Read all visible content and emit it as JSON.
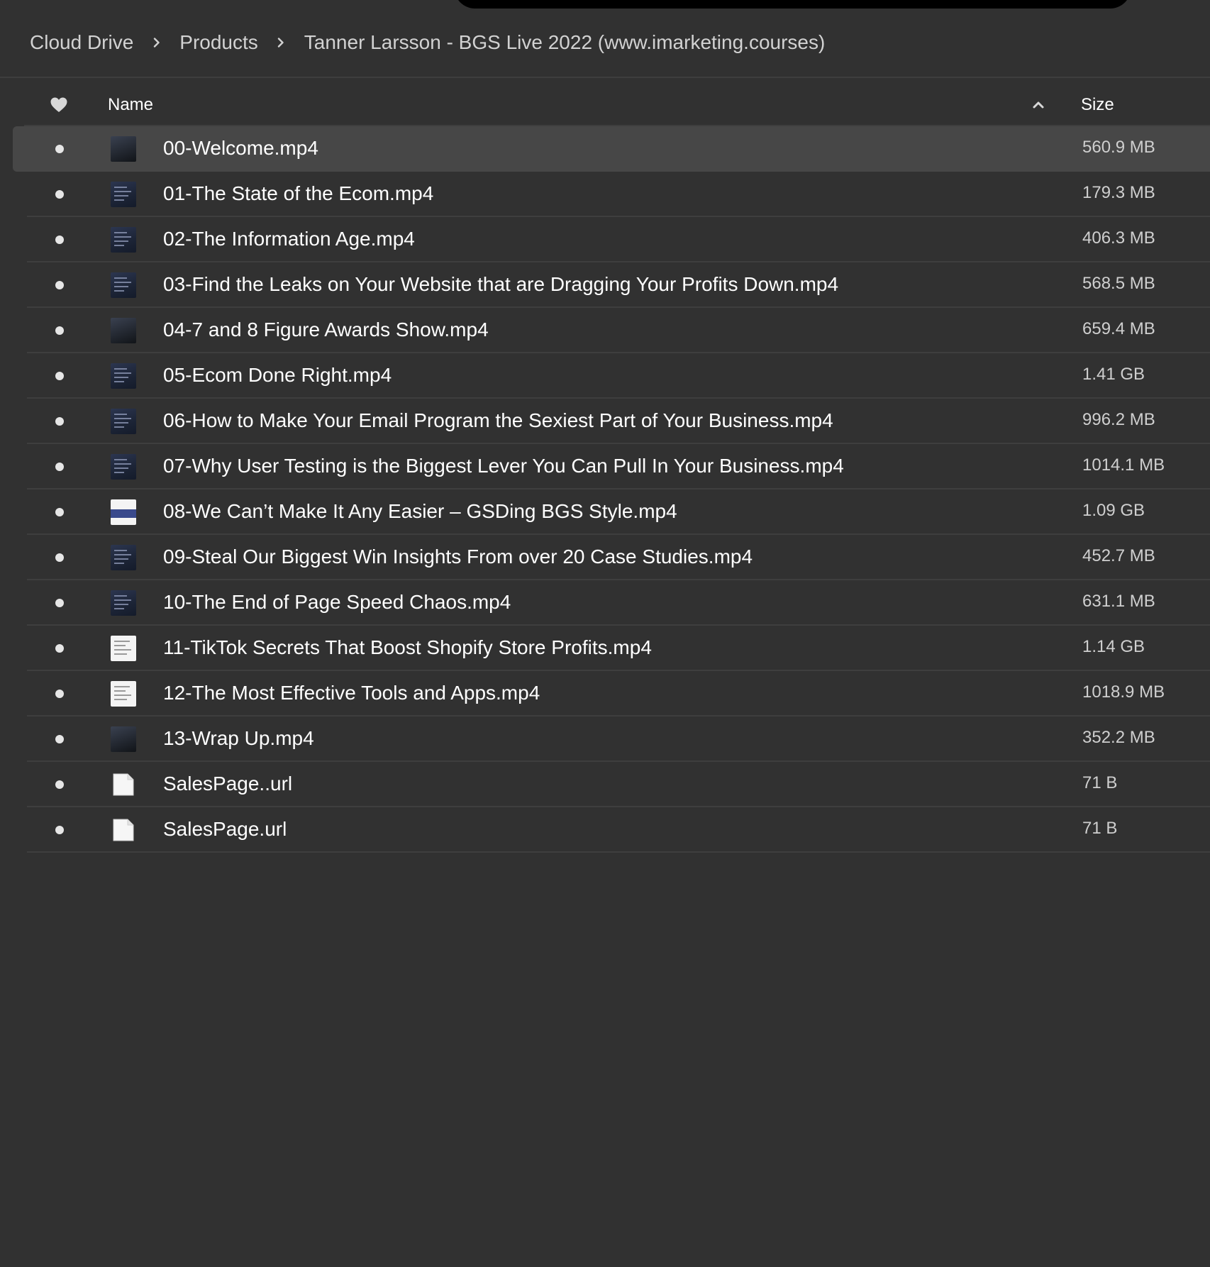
{
  "breadcrumb": {
    "items": [
      "Cloud Drive",
      "Products",
      "Tanner Larsson - BGS Live 2022 (www.imarketing.courses)"
    ]
  },
  "list": {
    "headers": {
      "name": "Name",
      "size": "Size"
    },
    "sort_icon": "chevron-up-icon",
    "favorite_icon": "heart-icon",
    "files": [
      {
        "name": "00-Welcome.mp4",
        "size": "560.9 MB",
        "thumb": "dark",
        "selected": true
      },
      {
        "name": "01-The State of the Ecom.mp4",
        "size": "179.3 MB",
        "thumb": "video"
      },
      {
        "name": "02-The Information Age.mp4",
        "size": "406.3 MB",
        "thumb": "video"
      },
      {
        "name": "03-Find the Leaks on Your Website that are Dragging Your Profits Down.mp4",
        "size": "568.5 MB",
        "thumb": "video"
      },
      {
        "name": "04-7 and 8 Figure Awards Show.mp4",
        "size": "659.4 MB",
        "thumb": "dark"
      },
      {
        "name": "05-Ecom Done Right.mp4",
        "size": "1.41 GB",
        "thumb": "video"
      },
      {
        "name": "06-How to Make Your Email Program the Sexiest Part of Your Business.mp4",
        "size": "996.2 MB",
        "thumb": "video"
      },
      {
        "name": "07-Why User Testing is the Biggest Lever You Can Pull In Your Business.mp4",
        "size": "1014.1 MB",
        "thumb": "video"
      },
      {
        "name": "08-We Can’t Make It Any Easier – GSDing BGS Style.mp4",
        "size": "1.09 GB",
        "thumb": "banded"
      },
      {
        "name": "09-Steal Our Biggest Win Insights From over 20 Case Studies.mp4",
        "size": "452.7 MB",
        "thumb": "video"
      },
      {
        "name": "10-The End of Page Speed Chaos.mp4",
        "size": "631.1 MB",
        "thumb": "video"
      },
      {
        "name": "11-TikTok Secrets That Boost Shopify Store Profits.mp4",
        "size": "1.14 GB",
        "thumb": "white"
      },
      {
        "name": "12-The Most Effective Tools and Apps.mp4",
        "size": "1018.9 MB",
        "thumb": "white"
      },
      {
        "name": "13-Wrap Up.mp4",
        "size": "352.2 MB",
        "thumb": "dark"
      },
      {
        "name": "SalesPage..url",
        "size": "71 B",
        "thumb": "doc"
      },
      {
        "name": "SalesPage.url",
        "size": "71 B",
        "thumb": "doc"
      }
    ]
  },
  "colors": {
    "background": "#313131",
    "row_selected": "#474747",
    "divider": "#3e3e3e",
    "text_primary": "#ffffff",
    "text_secondary": "#cfcfcf"
  }
}
